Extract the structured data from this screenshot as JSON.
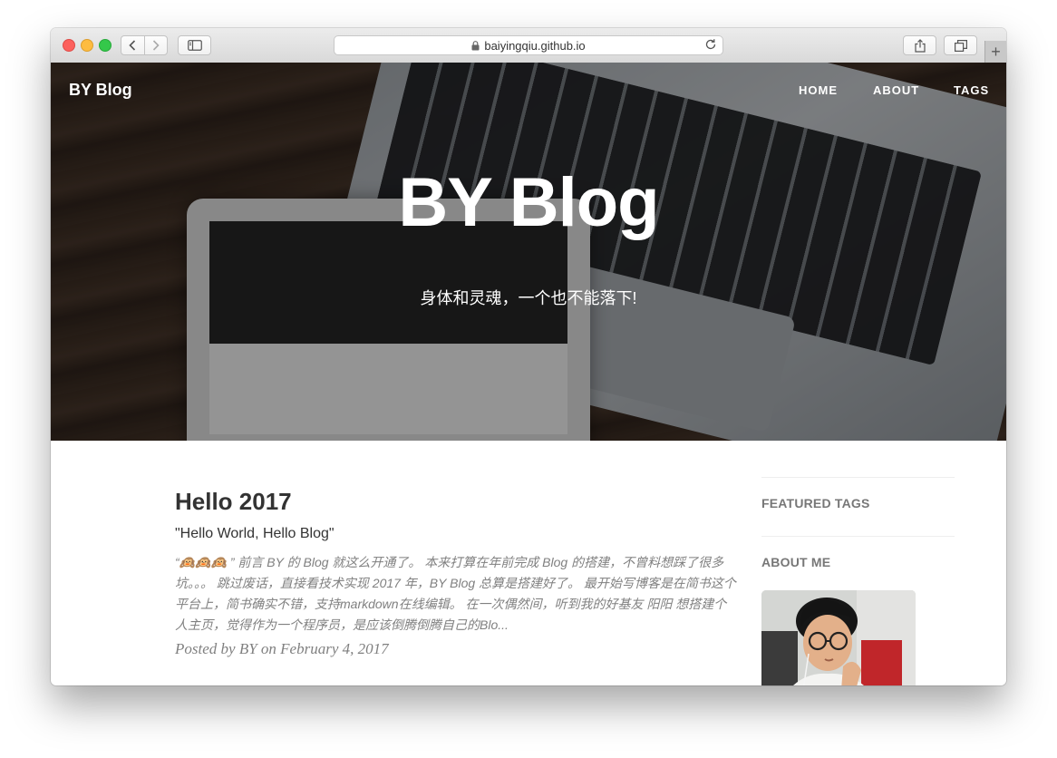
{
  "browser": {
    "url": "baiyingqiu.github.io",
    "new_tab_symbol": "+"
  },
  "site": {
    "brand": "BY Blog",
    "nav": [
      "HOME",
      "ABOUT",
      "TAGS"
    ],
    "hero_title": "BY Blog",
    "hero_subtitle": "身体和灵魂，一个也不能落下!"
  },
  "post": {
    "title": "Hello 2017",
    "subtitle": "\"Hello World, Hello Blog\"",
    "excerpt": "“🙉🙉🙉 ” 前言 BY 的 Blog 就这么开通了。 本来打算在年前完成 Blog 的搭建，不曾料想踩了很多坑。。。 跳过废话，直接看技术实现 2017 年，BY Blog 总算是搭建好了。 最开始写博客是在简书这个平台上，简书确实不错，支持markdown在线编辑。 在一次偶然间，听到我的好基友 阳阳 想搭建个人主页，觉得作为一个程序员，是应该倒腾倒腾自己的Blo...",
    "meta": "Posted by BY on February 4, 2017"
  },
  "sidebar": {
    "featured_tags": "FEATURED TAGS",
    "about_me": "ABOUT ME"
  }
}
